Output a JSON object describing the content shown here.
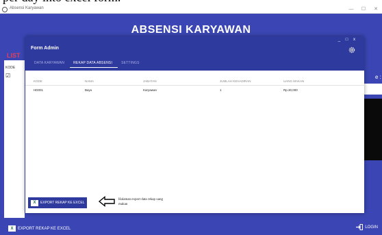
{
  "doc_caption": "per day into excel form.",
  "outer": {
    "title": "Absensi Karyawan",
    "heading": "ABSENSI KARYAWAN",
    "list_label": "LIST",
    "kode_label": "KODE",
    "right_colon": "e :",
    "export_label": "EXPORT REKAP KE EXCEL",
    "login_label": "LOGIN",
    "window_buttons": [
      "—",
      "☐",
      "✕"
    ]
  },
  "form_admin": {
    "title": "Form Admin",
    "window_controls": "_ □ x",
    "tabs": [
      {
        "label": "DATA KARYAWAN"
      },
      {
        "label": "REKAP DATA ABSENSI"
      },
      {
        "label": "SETTINGS"
      }
    ],
    "active_tab": 1,
    "table": {
      "headers": [
        "KODE",
        "NAMA",
        "JABATAN",
        "JUMLAH KEHADIRAN",
        "UANG MAKAN"
      ],
      "rows": [
        [
          "HD001",
          "Bayu",
          "Karyawan",
          "1",
          "Rp.30,000"
        ]
      ]
    },
    "export_label": "EXPORT REKAP KE EXCEL",
    "note": "Halaman export data rekap uang makan"
  },
  "colors": {
    "window_bg": "#3b46b4",
    "form_bg": "#2f3a9f",
    "excel_green": "#1d6f42",
    "list_accent": "#e0415a"
  }
}
